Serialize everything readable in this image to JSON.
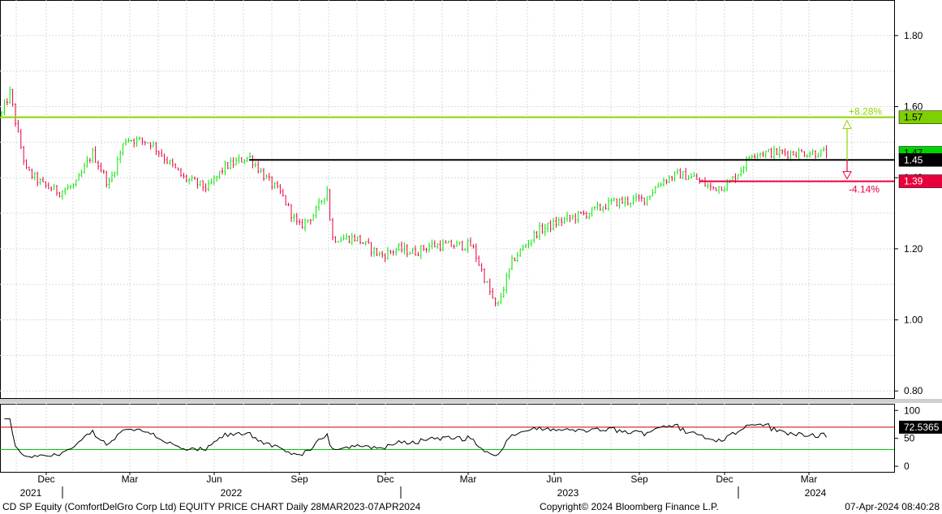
{
  "footer": {
    "left": "CD SP Equity (ComfortDelGro Corp Ltd) EQUITY PRICE CHART  Daily 28MAR2023-07APR2024",
    "center": "Copyright© 2024 Bloomberg Finance L.P.",
    "right": "07-Apr-2024 08:40:28"
  },
  "chart_data": [
    {
      "type": "candlestick",
      "panel": "price",
      "ylim": [
        0.78,
        1.9
      ],
      "ytick_labels": [
        "0.80",
        "1.00",
        "1.20",
        "1.40",
        "1.60",
        "1.80"
      ],
      "yticks": [
        0.8,
        1.0,
        1.2,
        1.4,
        1.6,
        1.8
      ],
      "month_labels": [
        "Dec",
        "Mar",
        "Jun",
        "Sep",
        "Dec",
        "Mar",
        "Jun",
        "Sep",
        "Dec",
        "Mar"
      ],
      "year_labels": [
        "2021",
        "2022",
        "2023",
        "2024"
      ],
      "grid": true,
      "up_color": "#00e600",
      "down_color": "#e8003c",
      "price_path": [
        [
          0,
          1.58
        ],
        [
          0.01,
          1.64
        ],
        [
          0.02,
          1.52
        ],
        [
          0.03,
          1.42
        ],
        [
          0.05,
          1.38
        ],
        [
          0.07,
          1.36
        ],
        [
          0.09,
          1.38
        ],
        [
          0.11,
          1.47
        ],
        [
          0.13,
          1.38
        ],
        [
          0.15,
          1.51
        ],
        [
          0.18,
          1.5
        ],
        [
          0.2,
          1.45
        ],
        [
          0.22,
          1.4
        ],
        [
          0.25,
          1.37
        ],
        [
          0.27,
          1.43
        ],
        [
          0.3,
          1.46
        ],
        [
          0.32,
          1.4
        ],
        [
          0.34,
          1.35
        ],
        [
          0.36,
          1.26
        ],
        [
          0.38,
          1.3
        ],
        [
          0.395,
          1.37
        ],
        [
          0.4,
          1.23
        ],
        [
          0.43,
          1.23
        ],
        [
          0.46,
          1.18
        ],
        [
          0.48,
          1.2
        ],
        [
          0.5,
          1.19
        ],
        [
          0.52,
          1.21
        ],
        [
          0.55,
          1.21
        ],
        [
          0.57,
          1.21
        ],
        [
          0.585,
          1.12
        ],
        [
          0.6,
          1.03
        ],
        [
          0.62,
          1.17
        ],
        [
          0.65,
          1.25
        ],
        [
          0.68,
          1.28
        ],
        [
          0.71,
          1.3
        ],
        [
          0.74,
          1.33
        ],
        [
          0.78,
          1.34
        ],
        [
          0.8,
          1.39
        ],
        [
          0.82,
          1.41
        ],
        [
          0.84,
          1.4
        ],
        [
          0.86,
          1.37
        ],
        [
          0.88,
          1.38
        ],
        [
          0.895,
          1.42
        ],
        [
          0.91,
          1.47
        ]
      ],
      "horizontal_lines": [
        {
          "value": 1.57,
          "color": "#8fd400",
          "label": "1.57",
          "annotation": "+8.28%"
        },
        {
          "value": 1.45,
          "color": "#000000",
          "label": "1.45"
        },
        {
          "value": 1.39,
          "color": "#e8003c",
          "label": "1.39",
          "annotation": "-4.14%"
        }
      ],
      "last_price_label": "1.47"
    },
    {
      "type": "line",
      "panel": "rsi",
      "ylim": [
        -10,
        112
      ],
      "ytick_labels": [
        "0",
        "50",
        "100"
      ],
      "yticks": [
        0,
        50,
        100
      ],
      "upper_band": 70,
      "lower_band": 30,
      "upper_band_color": "#cc0000",
      "lower_band_color": "#00cc00",
      "last_value_label": "72.5365"
    }
  ]
}
